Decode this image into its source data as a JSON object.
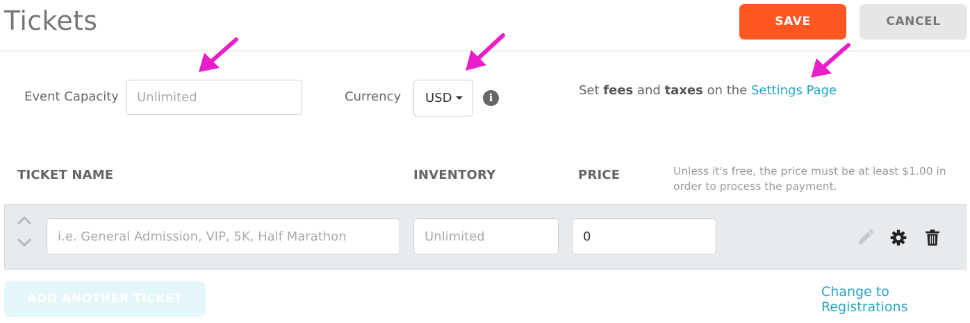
{
  "header": {
    "title": "Tickets",
    "save_label": "SAVE",
    "cancel_label": "CANCEL",
    "save_color": "#ff5722"
  },
  "settings": {
    "capacity_label": "Event Capacity",
    "capacity_placeholder": "Unlimited",
    "currency_label": "Currency",
    "currency_value": "USD",
    "info_icon": "info-circle-icon",
    "fees_prefix": "Set ",
    "fees_word": "fees",
    "fees_and": " and ",
    "taxes_word": "taxes",
    "fees_on": " on the ",
    "settings_link": "Settings Page",
    "link_color": "#26a4c6"
  },
  "table": {
    "columns": {
      "name": "TICKET NAME",
      "inventory": "INVENTORY",
      "price": "PRICE"
    },
    "price_hint": "Unless it's free, the price must be at least $1.00 in order to process the payment.",
    "rows": [
      {
        "name_placeholder": "i.e. General Admission, VIP, 5K, Half Marathon",
        "inventory_placeholder": "Unlimited",
        "price_value": "0"
      }
    ]
  },
  "footer": {
    "add_label": "ADD ANOTHER TICKET",
    "registrations_link": "Change to Registrations"
  },
  "annotation_color": "#e91ec8"
}
